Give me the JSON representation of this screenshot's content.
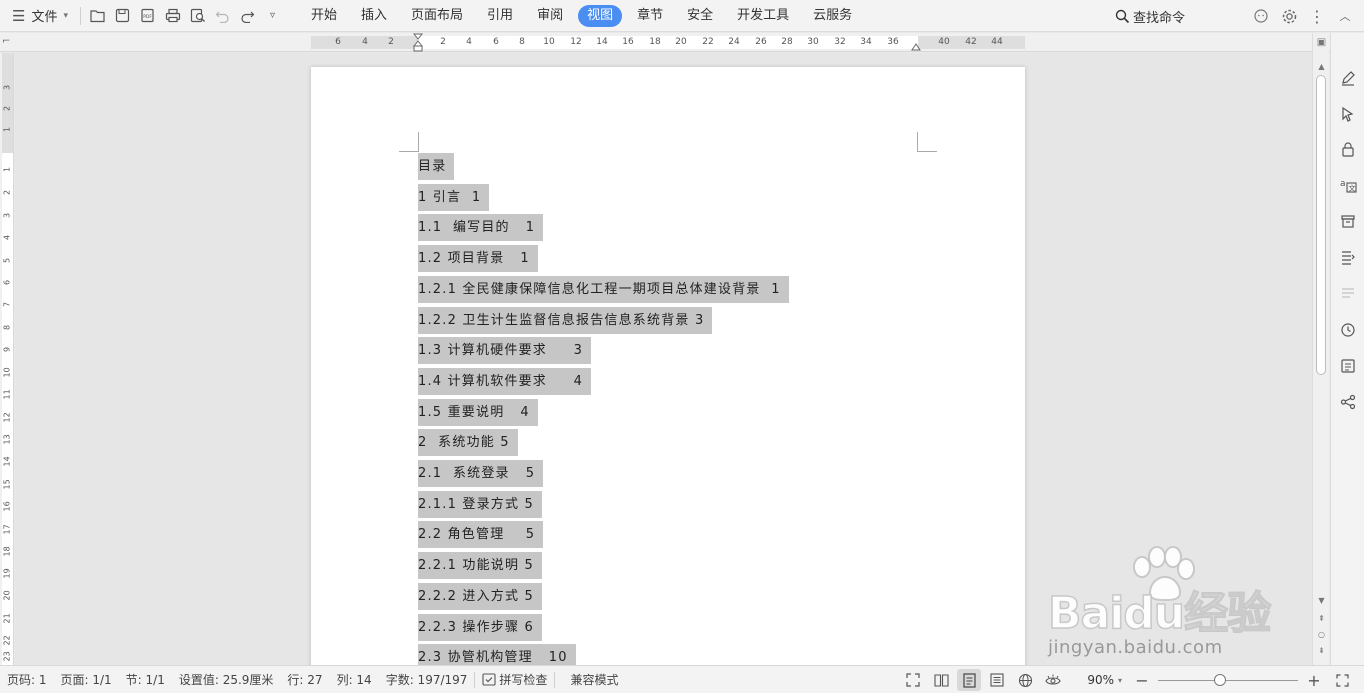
{
  "menubar": {
    "file_label": "文件",
    "quick_access_icons": [
      "open-folder-icon",
      "save-icon",
      "pdf-export-icon",
      "print-icon",
      "print-preview-icon",
      "undo-icon",
      "redo-icon",
      "more-dropdown-icon"
    ],
    "tabs": [
      {
        "label": "开始",
        "active": false
      },
      {
        "label": "插入",
        "active": false
      },
      {
        "label": "页面布局",
        "active": false
      },
      {
        "label": "引用",
        "active": false
      },
      {
        "label": "审阅",
        "active": false
      },
      {
        "label": "视图",
        "active": true
      },
      {
        "label": "章节",
        "active": false
      },
      {
        "label": "安全",
        "active": false
      },
      {
        "label": "开发工具",
        "active": false
      },
      {
        "label": "云服务",
        "active": false
      }
    ],
    "search_label": "查找命令",
    "accent_color": "#4a8ef2"
  },
  "ruler": {
    "horizontal_ticks": [
      "6",
      "4",
      "2",
      "2",
      "4",
      "6",
      "8",
      "10",
      "12",
      "14",
      "16",
      "18",
      "20",
      "22",
      "24",
      "26",
      "28",
      "30",
      "32",
      "34",
      "36",
      "40",
      "42",
      "44"
    ],
    "vertical_ticks": [
      "3",
      "2",
      "1",
      "1",
      "2",
      "3",
      "4",
      "5",
      "6",
      "7",
      "8",
      "9",
      "10",
      "11",
      "12",
      "13",
      "14",
      "15",
      "16",
      "17",
      "18",
      "19",
      "20",
      "21",
      "22",
      "23"
    ]
  },
  "document": {
    "toc": [
      "目录",
      "1 引言  1",
      "1.1  编写目的   1",
      "1.2 项目背景   1",
      "1.2.1 全民健康保障信息化工程一期项目总体建设背景  1",
      "1.2.2 卫生计生监督信息报告信息系统背景 3",
      "1.3 计算机硬件要求     3",
      "1.4 计算机软件要求     4",
      "1.5 重要说明   4",
      "2  系统功能 5",
      "2.1  系统登录   5",
      "2.1.1 登录方式 5",
      "2.2 角色管理    5",
      "2.2.1 功能说明 5",
      "2.2.2 进入方式 5",
      "2.2.3 操作步骤 6",
      "2.3 协管机构管理   10"
    ],
    "highlight_color": "#c6c6c6"
  },
  "sidebar_icons": [
    "pen-icon",
    "select-cursor-icon",
    "lock-icon",
    "translate-icon",
    "archive-icon",
    "outline-icon",
    "format-icon",
    "history-icon",
    "backup-icon",
    "share-icon"
  ],
  "statusbar": {
    "page_code": "页码: 1",
    "page": "页面: 1/1",
    "section": "节: 1/1",
    "setting": "设置值: 25.9厘米",
    "row": "行: 27",
    "col": "列: 14",
    "word_count": "字数: 197/197",
    "spell_check": "拼写检查",
    "compat_mode": "兼容模式",
    "zoom": "90%"
  },
  "watermark": {
    "brand": "Baidu经验",
    "url": "jingyan.baidu.com"
  }
}
